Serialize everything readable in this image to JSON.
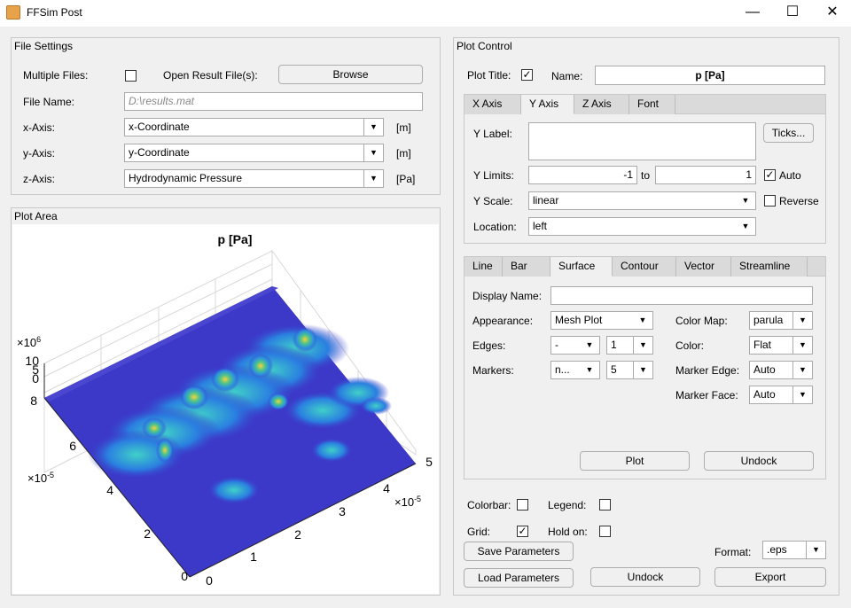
{
  "window": {
    "title": "FFSim Post",
    "minimize": "—",
    "maximize": "☐",
    "close": "✕"
  },
  "file_settings": {
    "title": "File Settings",
    "multiple_files_label": "Multiple Files:",
    "open_result_label": "Open Result File(s):",
    "browse_label": "Browse",
    "file_name_label": "File Name:",
    "file_name_placeholder": "D:\\results.mat",
    "x_axis_label": "x-Axis:",
    "x_axis_value": "x-Coordinate",
    "x_unit": "[m]",
    "y_axis_label": "y-Axis:",
    "y_axis_value": "y-Coordinate",
    "y_unit": "[m]",
    "z_axis_label": "z-Axis:",
    "z_axis_value": "Hydrodynamic Pressure",
    "z_unit": "[Pa]"
  },
  "plot_area": {
    "title": "Plot Area",
    "plot_title": "p [Pa]",
    "z_exp": "×10",
    "z_exp_power": "6",
    "z_ticks": [
      "10",
      "5",
      "0"
    ],
    "y_exp": "×10",
    "y_exp_power": "-5",
    "y_ticks": [
      "8",
      "6",
      "4",
      "2",
      "0"
    ],
    "x_exp": "×10",
    "x_exp_power": "-5",
    "x_ticks": [
      "0",
      "1",
      "2",
      "3",
      "4",
      "5"
    ]
  },
  "plot_control": {
    "title": "Plot Control",
    "plot_title_label": "Plot Title:",
    "plot_title_checked": "✓",
    "name_label": "Name:",
    "name_value": "p [Pa]",
    "axis_tabs": [
      "X Axis",
      "Y Axis",
      "Z Axis",
      "Font"
    ],
    "y_label_label": "Y Label:",
    "ticks_button": "Ticks...",
    "y_limits_label": "Y Limits:",
    "y_min": "-1",
    "to_label": "to",
    "y_max": "1",
    "auto_label": "Auto",
    "auto_checked": "✓",
    "y_scale_label": "Y Scale:",
    "y_scale_value": "linear",
    "reverse_label": "Reverse",
    "location_label": "Location:",
    "location_value": "left",
    "plot_tabs": [
      "Line",
      "Bar",
      "Surface",
      "Contour",
      "Vector",
      "Streamline"
    ],
    "display_name_label": "Display Name:",
    "appearance_label": "Appearance:",
    "appearance_value": "Mesh Plot",
    "edges_label": "Edges:",
    "edges_style": "-",
    "edges_width": "1",
    "markers_label": "Markers:",
    "markers_style": "n...",
    "markers_size": "5",
    "color_map_label": "Color Map:",
    "color_map_value": "parula",
    "color_label": "Color:",
    "color_value": "Flat",
    "marker_edge_label": "Marker Edge:",
    "marker_edge_value": "Auto",
    "marker_face_label": "Marker Face:",
    "marker_face_value": "Auto",
    "plot_button": "Plot",
    "undock_button_inner": "Undock",
    "colorbar_label": "Colorbar:",
    "legend_label": "Legend:",
    "grid_label": "Grid:",
    "grid_checked": "✓",
    "hold_on_label": "Hold on:",
    "save_params_button": "Save Parameters",
    "format_label": "Format:",
    "format_value": ".eps",
    "load_params_button": "Load Parameters",
    "undock_button": "Undock",
    "export_button": "Export"
  },
  "colors": {
    "accent_bg": "#f0f0f0",
    "surface_base": "#3c38c8",
    "surface_peak": "#f5d23a"
  }
}
